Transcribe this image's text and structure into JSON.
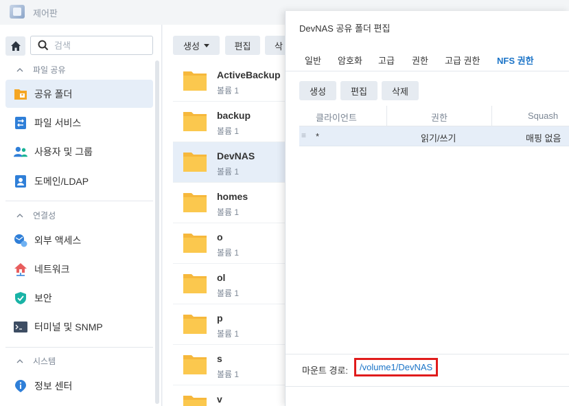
{
  "app": {
    "title": "제어판"
  },
  "search": {
    "placeholder": "검색"
  },
  "sidebar": {
    "sections": [
      {
        "label": "파일 공유"
      },
      {
        "label": "연결성"
      },
      {
        "label": "시스템"
      }
    ],
    "items": [
      {
        "label": "공유 폴더"
      },
      {
        "label": "파일 서비스"
      },
      {
        "label": "사용자 및 그룹"
      },
      {
        "label": "도메인/LDAP"
      },
      {
        "label": "외부 액세스"
      },
      {
        "label": "네트워크"
      },
      {
        "label": "보안"
      },
      {
        "label": "터미널 및 SNMP"
      },
      {
        "label": "정보 센터"
      }
    ]
  },
  "toolbar": {
    "create_label": "생성",
    "edit_label": "편집",
    "delete_label": "삭"
  },
  "folders": [
    {
      "name": "ActiveBackup",
      "volume": "볼륨 1"
    },
    {
      "name": "backup",
      "volume": "볼륨 1"
    },
    {
      "name": "DevNAS",
      "volume": "볼륨 1"
    },
    {
      "name": "homes",
      "volume": "볼륨 1"
    },
    {
      "name": "o",
      "volume": "볼륨 1"
    },
    {
      "name": "ol",
      "volume": "볼륨 1"
    },
    {
      "name": "p",
      "volume": "볼륨 1"
    },
    {
      "name": "s",
      "volume": "볼륨 1"
    },
    {
      "name": "v",
      "volume": ""
    }
  ],
  "dialog": {
    "title": "DevNAS 공유 폴더 편집",
    "tabs": [
      {
        "label": "일반"
      },
      {
        "label": "암호화"
      },
      {
        "label": "고급"
      },
      {
        "label": "권한"
      },
      {
        "label": "고급 권한"
      },
      {
        "label": "NFS 권한"
      }
    ],
    "buttons": {
      "create": "생성",
      "edit": "편집",
      "delete": "삭제"
    },
    "columns": {
      "client": "클라이언트",
      "privilege": "권한",
      "squash": "Squash"
    },
    "rows": [
      {
        "client": "*",
        "privilege": "읽기/쓰기",
        "squash": "매핑 없음"
      }
    ],
    "mount_label": "마운트 경로:",
    "mount_path": "/volume1/DevNAS"
  },
  "colors": {
    "accent": "#1a73c7",
    "highlight": "#e01b1b",
    "selected_bg": "#e6eef8"
  }
}
